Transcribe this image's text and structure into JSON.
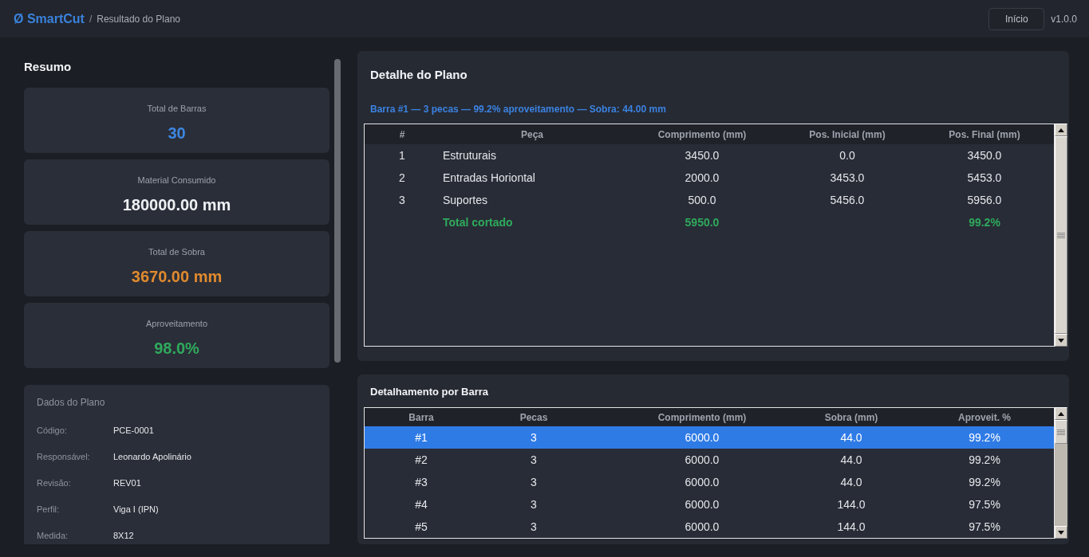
{
  "header": {
    "logo": "Ø SmartCut",
    "separator": "/",
    "page_title": "Resultado do Plano",
    "home_button": "Início",
    "version": "v1.0.0"
  },
  "summary": {
    "title": "Resumo",
    "cards": [
      {
        "label": "Total de Barras",
        "value": "30",
        "color": "#3d86e0"
      },
      {
        "label": "Material Consumido",
        "value": "180000.00 mm",
        "color": "#eef0f3"
      },
      {
        "label": "Total de Sobra",
        "value": "3670.00 mm",
        "color": "#e08a2e"
      },
      {
        "label": "Aproveitamento",
        "value": "98.0%",
        "color": "#2faa5c"
      }
    ]
  },
  "plan_data": {
    "title": "Dados do Plano",
    "fields": [
      {
        "label": "Código:",
        "value": "PCE-0001"
      },
      {
        "label": "Responsável:",
        "value": "Leonardo Apolinário"
      },
      {
        "label": "Revisão:",
        "value": "REV01"
      },
      {
        "label": "Perfil:",
        "value": "Viga I (IPN)"
      },
      {
        "label": "Medida:",
        "value": "8X12"
      }
    ]
  },
  "plan_detail": {
    "title": "Detalhe do Plano",
    "summary_line": "Barra #1 — 3 pecas — 99.2% aproveitamento — Sobra: 44.00 mm",
    "columns": [
      "#",
      "Peça",
      "Comprimento (mm)",
      "Pos. Inicial (mm)",
      "Pos. Final (mm)"
    ],
    "rows": [
      {
        "kind": "piece",
        "number": "1",
        "piece": "Estruturais",
        "length": "3450.0",
        "start": "0.0",
        "end": "3450.0"
      },
      {
        "kind": "piece",
        "number": "2",
        "piece": "Entradas Horiontal",
        "length": "2000.0",
        "start": "3453.0",
        "end": "5453.0"
      },
      {
        "kind": "piece",
        "number": "3",
        "piece": "Suportes",
        "length": "500.0",
        "start": "5456.0",
        "end": "5956.0"
      },
      {
        "kind": "total",
        "piece": "Total cortado",
        "length": "5950.0",
        "end": "99.2%"
      }
    ]
  },
  "bar_breakdown": {
    "title": "Detalhamento por Barra",
    "columns": [
      "Barra",
      "Pecas",
      "Comprimento (mm)",
      "Sobra (mm)",
      "Aproveit. %"
    ],
    "rows": [
      {
        "bar": "#1",
        "pieces": "3",
        "length": "6000.0",
        "leftover": "44.0",
        "usage": "99.2%",
        "selected": true
      },
      {
        "bar": "#2",
        "pieces": "3",
        "length": "6000.0",
        "leftover": "44.0",
        "usage": "99.2%",
        "selected": false
      },
      {
        "bar": "#3",
        "pieces": "3",
        "length": "6000.0",
        "leftover": "44.0",
        "usage": "99.2%",
        "selected": false
      },
      {
        "bar": "#4",
        "pieces": "3",
        "length": "6000.0",
        "leftover": "144.0",
        "usage": "97.5%",
        "selected": false
      },
      {
        "bar": "#5",
        "pieces": "3",
        "length": "6000.0",
        "leftover": "144.0",
        "usage": "97.5%",
        "selected": false
      }
    ]
  }
}
